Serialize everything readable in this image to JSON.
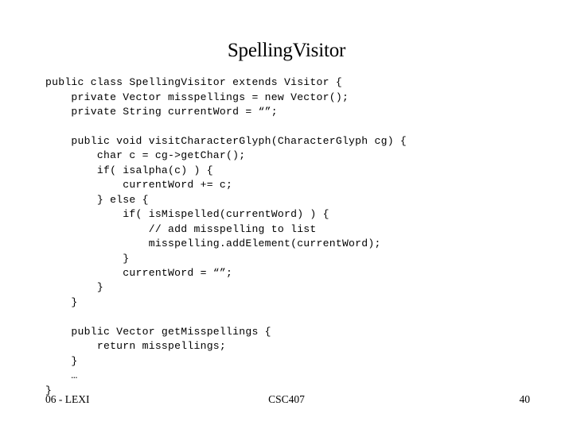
{
  "slide": {
    "title": "SpellingVisitor",
    "background_color": "#ffffff",
    "text_color": "#000000"
  },
  "code": {
    "language": "java",
    "lines": [
      "public class SpellingVisitor extends Visitor {",
      "    private Vector misspellings = new Vector();",
      "    private String currentWord = “”;",
      "",
      "    public void visitCharacterGlyph(CharacterGlyph cg) {",
      "        char c = cg->getChar();",
      "        if( isalpha(c) ) {",
      "            currentWord += c;",
      "        } else {",
      "            if( isMispelled(currentWord) ) {",
      "                // add misspelling to list",
      "                misspelling.addElement(currentWord);",
      "            }",
      "            currentWord = “”;",
      "        }",
      "    }",
      "",
      "    public Vector getMisspellings {",
      "        return misspellings;",
      "    }",
      "    …",
      "}"
    ]
  },
  "footer": {
    "left": "06 - LEXI",
    "center": "CSC407",
    "page_number": "40"
  }
}
